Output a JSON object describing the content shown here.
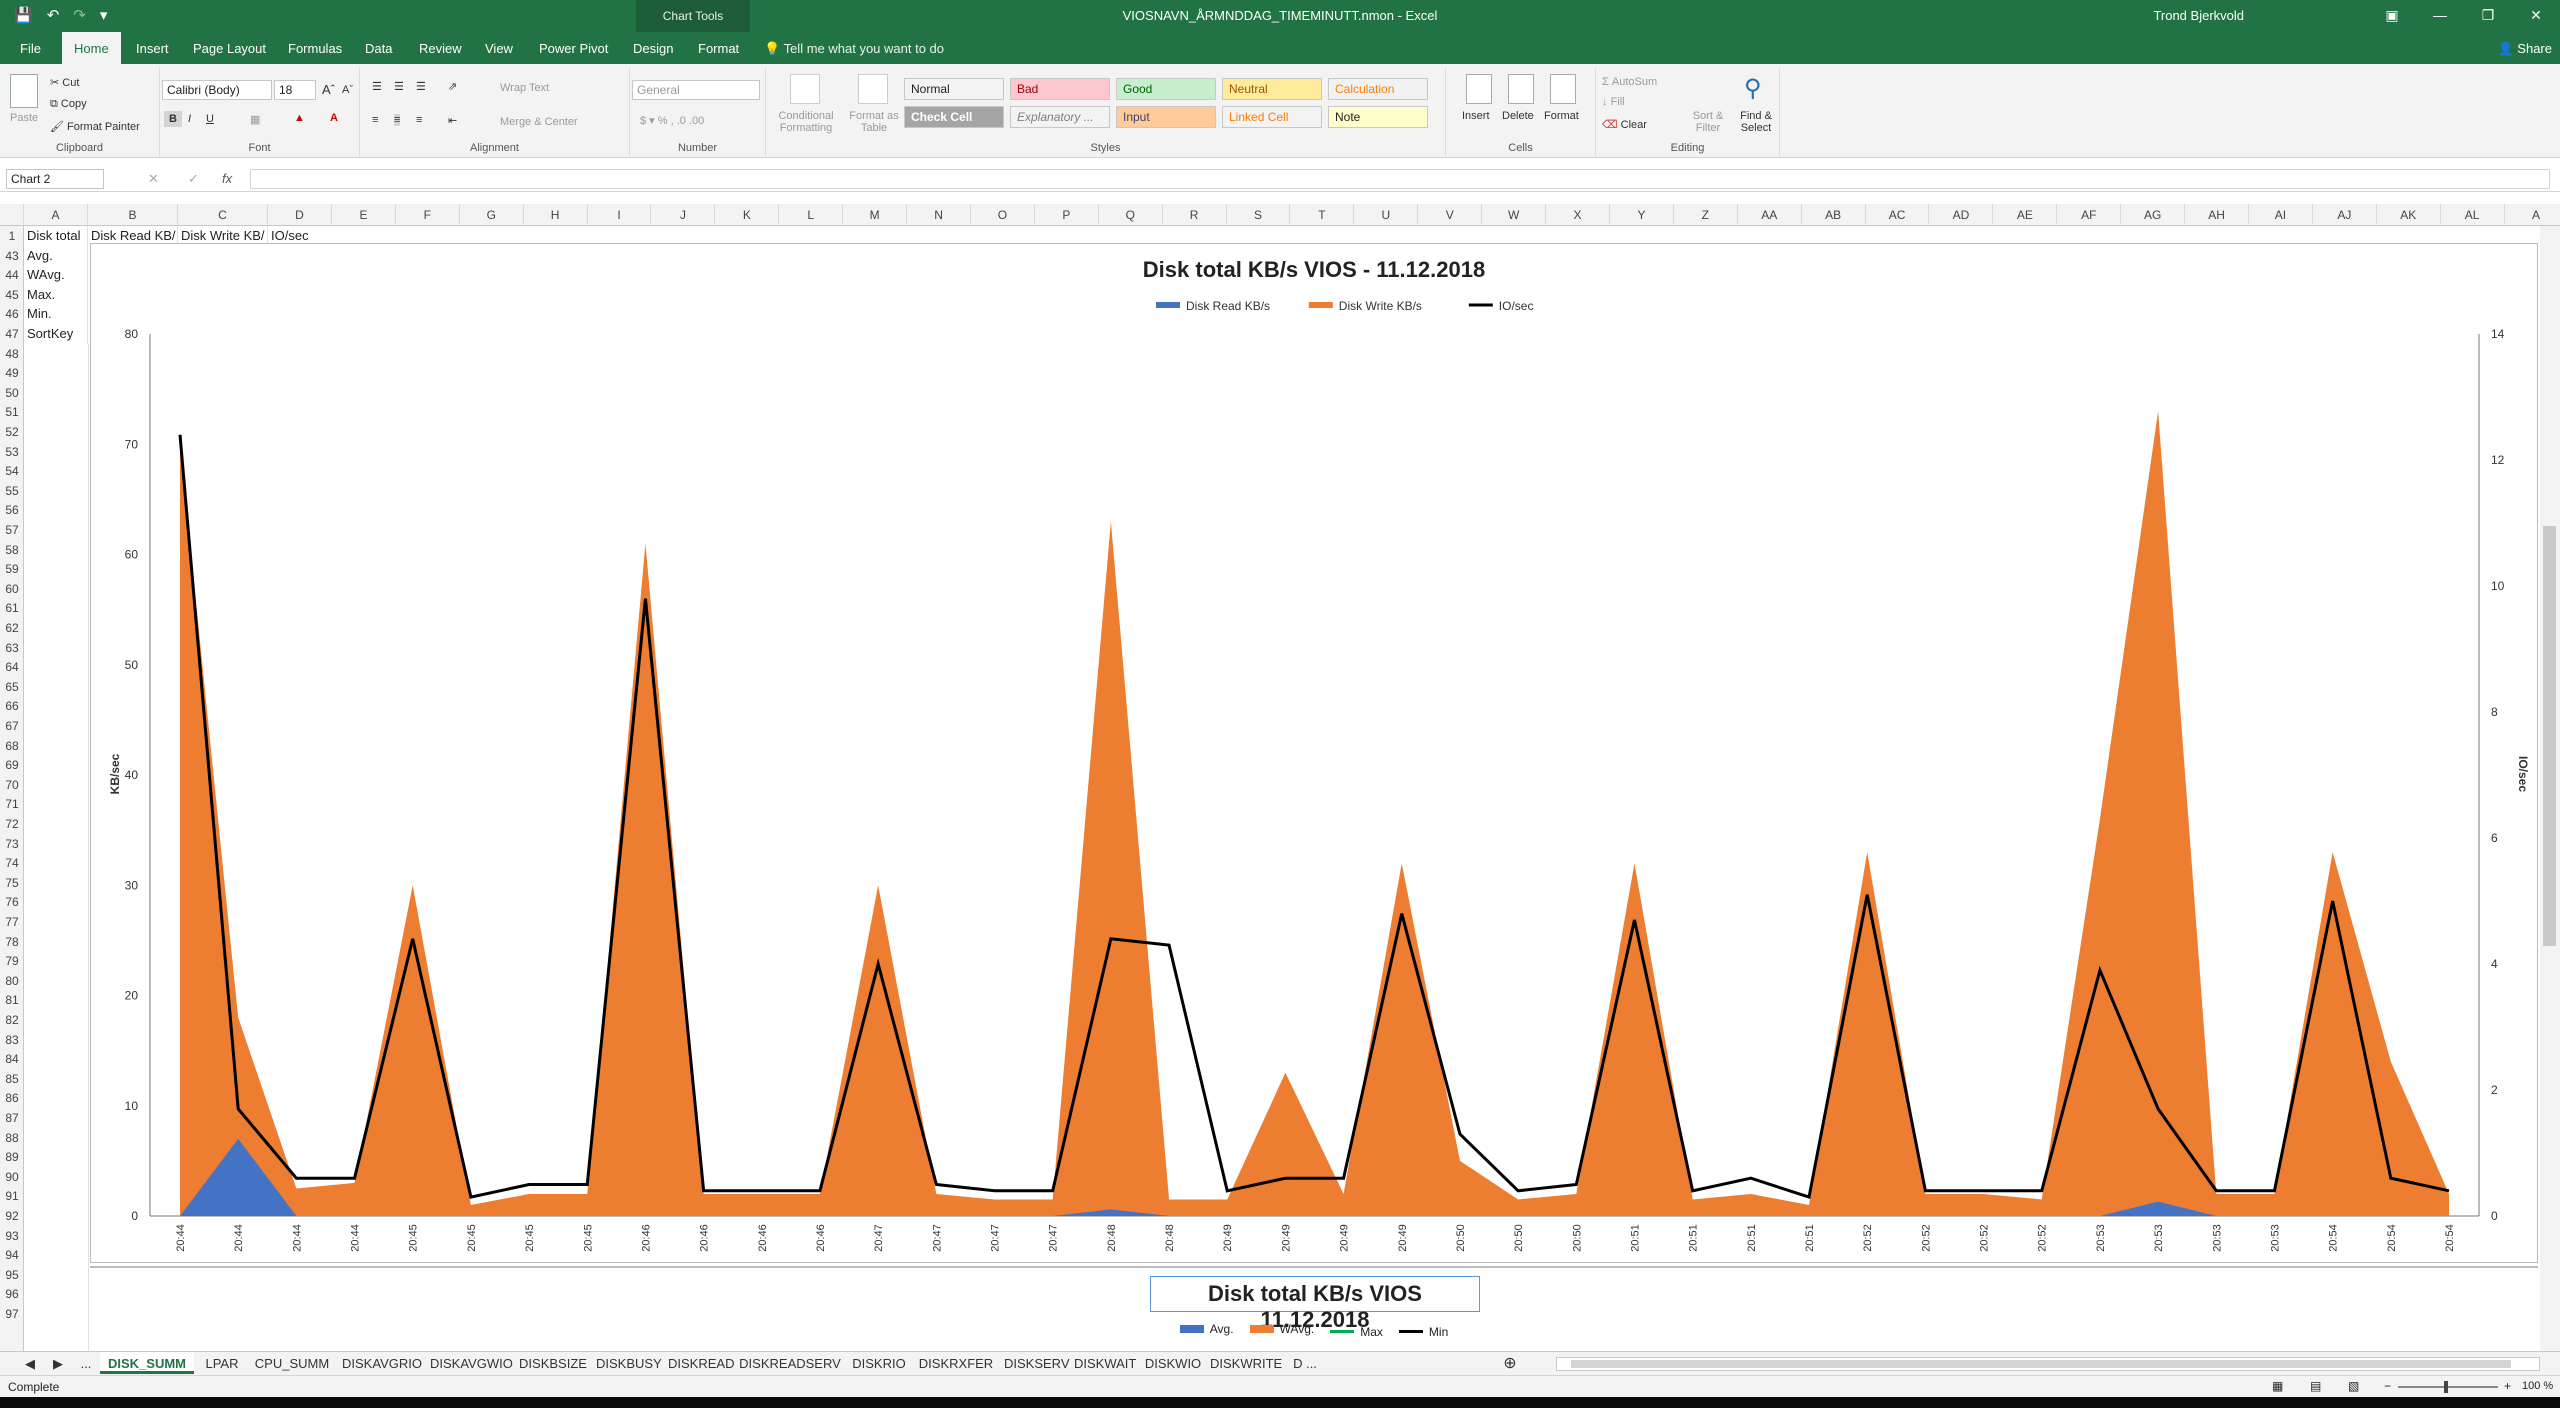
{
  "titlebar": {
    "title": "VIOSNAVN_ÅRMNDDAG_TIMEMINUTT.nmon  -  Excel",
    "chart_tools": "Chart Tools",
    "user": "Trond Bjerkvold"
  },
  "tabs": [
    "File",
    "Home",
    "Insert",
    "Page Layout",
    "Formulas",
    "Data",
    "Review",
    "View",
    "Power Pivot",
    "Design",
    "Format"
  ],
  "tell_me": "Tell me what you want to do",
  "share": "Share",
  "ribbon": {
    "clipboard": {
      "paste": "Paste",
      "cut": "Cut",
      "copy": "Copy",
      "format_painter": "Format Painter",
      "label": "Clipboard"
    },
    "font": {
      "name": "Calibri (Body)",
      "size": "18",
      "label": "Font",
      "bold": "B",
      "italic": "I",
      "underline": "U"
    },
    "alignment": {
      "wrap": "Wrap Text",
      "merge": "Merge & Center",
      "label": "Alignment"
    },
    "number": {
      "format": "General",
      "label": "Number"
    },
    "styles": {
      "conditional": "Conditional Formatting",
      "format_table": "Format as Table",
      "label": "Styles",
      "cells": [
        "Normal",
        "Bad",
        "Good",
        "Neutral",
        "Calculation",
        "Check Cell",
        "Explanatory ...",
        "Input",
        "Linked Cell",
        "Note"
      ]
    },
    "cells": {
      "insert": "Insert",
      "delete": "Delete",
      "format": "Format",
      "label": "Cells"
    },
    "editing": {
      "autosum": "AutoSum",
      "fill": "Fill",
      "clear": "Clear",
      "sort": "Sort & Filter",
      "find": "Find & Select",
      "label": "Editing"
    }
  },
  "formula_bar": {
    "name_box": "Chart 2",
    "fx": "fx",
    "value": ""
  },
  "columns": [
    "A",
    "B",
    "C",
    "D",
    "E",
    "F",
    "G",
    "H",
    "I",
    "J",
    "K",
    "L",
    "M",
    "N",
    "O",
    "P",
    "Q",
    "R",
    "S",
    "T",
    "U",
    "V",
    "W",
    "X",
    "Y",
    "Z",
    "AA",
    "AB",
    "AC",
    "AD",
    "AE",
    "AF",
    "AG",
    "AH",
    "AI",
    "AJ",
    "AK",
    "AL",
    "A"
  ],
  "rows": [
    "1",
    "43",
    "44",
    "45",
    "46",
    "47",
    "48",
    "49",
    "50",
    "51",
    "52",
    "53",
    "54",
    "55",
    "56",
    "57",
    "58",
    "59",
    "60",
    "61",
    "62",
    "63",
    "64",
    "65",
    "66",
    "67",
    "68",
    "69",
    "70",
    "71",
    "72",
    "73",
    "74",
    "75",
    "76",
    "77",
    "78",
    "79",
    "80",
    "81",
    "82",
    "83",
    "84",
    "85",
    "86",
    "87",
    "88",
    "89",
    "90",
    "91",
    "92",
    "93",
    "94",
    "95",
    "96",
    "97"
  ],
  "cells": {
    "A1": "Disk total",
    "B1": "Disk Read KB/",
    "C1": "Disk Write KB/",
    "D1": "IO/sec",
    "A43": "Avg.",
    "A44": "WAvg.",
    "A45": "Max.",
    "A46": "Min.",
    "A47": "SortKey"
  },
  "chart_data": {
    "type": "area",
    "title": "Disk total KB/s VIOS - 11.12.2018",
    "ylabel": "KB/sec",
    "y2label": "IO/sec",
    "ylim": [
      0,
      80
    ],
    "y2lim": [
      0,
      14
    ],
    "yticks": [
      "0",
      "10",
      "20",
      "30",
      "40",
      "50",
      "60",
      "70",
      "80"
    ],
    "y2ticks": [
      "0",
      "2",
      "4",
      "6",
      "8",
      "10",
      "12",
      "14"
    ],
    "legend_position": "top",
    "categories": [
      "20:44",
      "20:44",
      "20:44",
      "20:44",
      "20:45",
      "20:45",
      "20:45",
      "20:45",
      "20:46",
      "20:46",
      "20:46",
      "20:46",
      "20:47",
      "20:47",
      "20:47",
      "20:47",
      "20:48",
      "20:48",
      "20:49",
      "20:49",
      "20:49",
      "20:49",
      "20:50",
      "20:50",
      "20:50",
      "20:51",
      "20:51",
      "20:51",
      "20:51",
      "20:52",
      "20:52",
      "20:52",
      "20:52",
      "20:53",
      "20:53",
      "20:53",
      "20:53",
      "20:54",
      "20:54",
      "20:54"
    ],
    "series": [
      {
        "name": "Disk Read KB/s",
        "color": "#4472c4",
        "type": "area",
        "axis": "left",
        "values": [
          0,
          7,
          0,
          0,
          0,
          0,
          0,
          0,
          0,
          0,
          0,
          0,
          0,
          0,
          0,
          0,
          0.6,
          0,
          0,
          0,
          0,
          0,
          0,
          0,
          0,
          0,
          0,
          0,
          0,
          0,
          0,
          0,
          0,
          0,
          1.3,
          0,
          0,
          0,
          0,
          0
        ]
      },
      {
        "name": "Disk Write KB/s",
        "color": "#ed7d31",
        "type": "area",
        "axis": "left",
        "values": [
          70,
          18,
          2.5,
          3,
          30,
          1,
          2,
          2,
          61,
          2,
          2,
          2,
          30,
          2,
          1.5,
          1.5,
          63,
          1.5,
          1.5,
          13,
          2,
          32,
          5,
          1.5,
          2,
          32,
          1.5,
          2,
          1,
          33,
          2,
          2,
          1.5,
          36,
          73,
          2,
          2,
          33,
          14,
          2
        ]
      },
      {
        "name": "IO/sec",
        "color": "#000000",
        "type": "line",
        "axis": "right",
        "values": [
          12.4,
          1.7,
          0.6,
          0.6,
          4.4,
          0.3,
          0.5,
          0.5,
          9.8,
          0.4,
          0.4,
          0.4,
          4,
          0.5,
          0.4,
          0.4,
          4.4,
          4.3,
          0.4,
          0.6,
          0.6,
          4.8,
          1.3,
          0.4,
          0.5,
          4.7,
          0.4,
          0.6,
          0.3,
          5.1,
          0.4,
          0.4,
          0.4,
          3.9,
          1.7,
          0.4,
          0.4,
          5,
          0.6,
          0.4
        ]
      }
    ]
  },
  "chart2": {
    "title": "Disk total KB/s VIOS  11.12.2018",
    "legend": [
      {
        "name": "Avg.",
        "color": "#4472c4"
      },
      {
        "name": "WAvg.",
        "color": "#ed7d31"
      },
      {
        "name": "Max",
        "color": "#00b050"
      },
      {
        "name": "Min",
        "color": "#000000"
      }
    ]
  },
  "sheets": [
    "DISK_SUMM",
    "LPAR",
    "CPU_SUMM",
    "DISKAVGRIO",
    "DISKAVGWIO",
    "DISKBSIZE",
    "DISKBUSY",
    "DISKREAD",
    "DISKREADSERV",
    "DISKRIO",
    "DISKRXFER",
    "DISKSERV",
    "DISKWAIT",
    "DISKWIO",
    "DISKWRITE",
    "D ..."
  ],
  "status": {
    "text": "Complete",
    "zoom": "100 %"
  }
}
